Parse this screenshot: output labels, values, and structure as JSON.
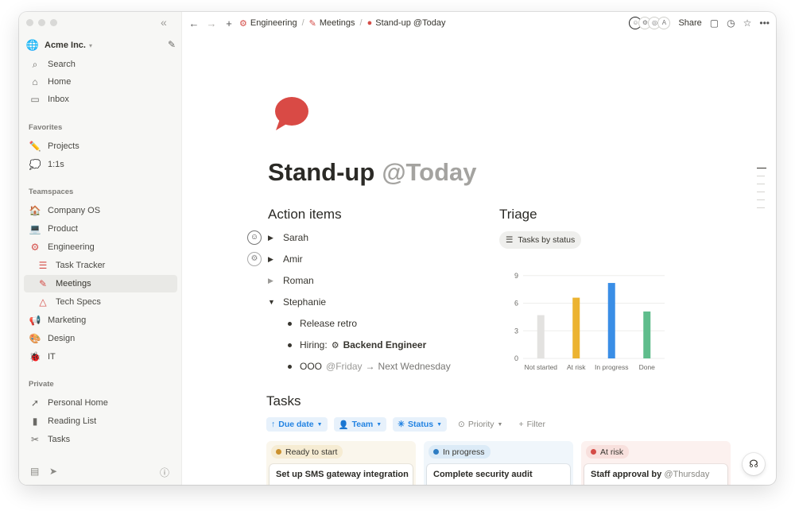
{
  "sidebar": {
    "workspace": {
      "name": "Acme Inc."
    },
    "top_items": [
      {
        "label": "Search",
        "icon": "search-icon"
      },
      {
        "label": "Home",
        "icon": "home-icon"
      },
      {
        "label": "Inbox",
        "icon": "inbox-icon"
      }
    ],
    "favorites_label": "Favorites",
    "favorites": [
      {
        "label": "Projects",
        "icon": "pencil-icon"
      },
      {
        "label": "1:1s",
        "icon": "speech-bubble-icon"
      }
    ],
    "teamspaces_label": "Teamspaces",
    "teamspaces": [
      {
        "label": "Company OS",
        "icon": "house-icon"
      },
      {
        "label": "Product",
        "icon": "laptop-icon"
      },
      {
        "label": "Engineering",
        "icon": "gear-icon"
      },
      {
        "label": "Task Tracker",
        "icon": "checklist-icon"
      },
      {
        "label": "Meetings",
        "icon": "pencil-icon"
      },
      {
        "label": "Tech Specs",
        "icon": "triangle-ruler-icon"
      },
      {
        "label": "Marketing",
        "icon": "megaphone-icon"
      },
      {
        "label": "Design",
        "icon": "palette-icon"
      },
      {
        "label": "IT",
        "icon": "bug-icon"
      }
    ],
    "private_label": "Private",
    "private": [
      {
        "label": "Personal Home",
        "icon": "compass-icon"
      },
      {
        "label": "Reading List",
        "icon": "book-icon"
      },
      {
        "label": "Tasks",
        "icon": "scissors-icon"
      }
    ]
  },
  "topbar": {
    "breadcrumbs": [
      {
        "label": "Engineering",
        "icon": "gear-icon"
      },
      {
        "label": "Meetings",
        "icon": "pencil-icon"
      },
      {
        "label": "Stand-up @Today",
        "icon": "speech-bubble-icon"
      }
    ],
    "avatar_initial": "A",
    "share_label": "Share"
  },
  "page": {
    "title": "Stand-up",
    "title_mention": "@Today",
    "action_items": {
      "heading": "Action items",
      "people": [
        {
          "name": "Sarah",
          "expanded": false
        },
        {
          "name": "Amir",
          "expanded": false
        },
        {
          "name": "Roman",
          "expanded": false
        },
        {
          "name": "Stephanie",
          "expanded": true
        }
      ],
      "stephanie_items": {
        "retro": "Release retro",
        "hiring_label": "Hiring:",
        "hiring_role": "Backend Engineer",
        "ooo_label": "OOO",
        "ooo_from": "@Friday",
        "ooo_arrow": "→",
        "ooo_to": "Next Wednesday"
      }
    },
    "triage": {
      "heading": "Triage",
      "view_button": "Tasks by status"
    },
    "tasks": {
      "heading": "Tasks",
      "filters": [
        {
          "label": "Due date",
          "icon": "arrow-up-icon"
        },
        {
          "label": "Team",
          "icon": "person-icon"
        },
        {
          "label": "Status",
          "icon": "status-icon"
        },
        {
          "label": "Priority",
          "icon": "priority-icon"
        },
        {
          "label": "Filter",
          "icon": "plus-icon"
        }
      ],
      "columns": [
        {
          "status": "Ready to start",
          "color": "#cb912f",
          "tint": "#faf6ec",
          "pill": "#f6ecd3",
          "card": "Set up SMS gateway integration",
          "card_mention": ""
        },
        {
          "status": "In progress",
          "color": "#2e7dc3",
          "tint": "#f0f6fb",
          "pill": "#dcebf7",
          "card": "Complete security audit",
          "card_mention": ""
        },
        {
          "status": "At risk",
          "color": "#d44c47",
          "tint": "#fcf1ef",
          "pill": "#f8e0dd",
          "card": "Staff approval by",
          "card_mention": "@Thursday"
        }
      ]
    }
  },
  "chart_data": {
    "type": "bar",
    "title": "",
    "categories": [
      "Not started",
      "At risk",
      "In progress",
      "Done"
    ],
    "values": [
      4.7,
      6.6,
      8.2,
      5.1
    ],
    "colors": [
      "#e3e2e0",
      "#ecb331",
      "#3a8ee6",
      "#5fbd8c"
    ],
    "yticks": [
      0,
      3,
      6,
      9
    ],
    "ylim": [
      0,
      9.5
    ],
    "grid": true
  }
}
